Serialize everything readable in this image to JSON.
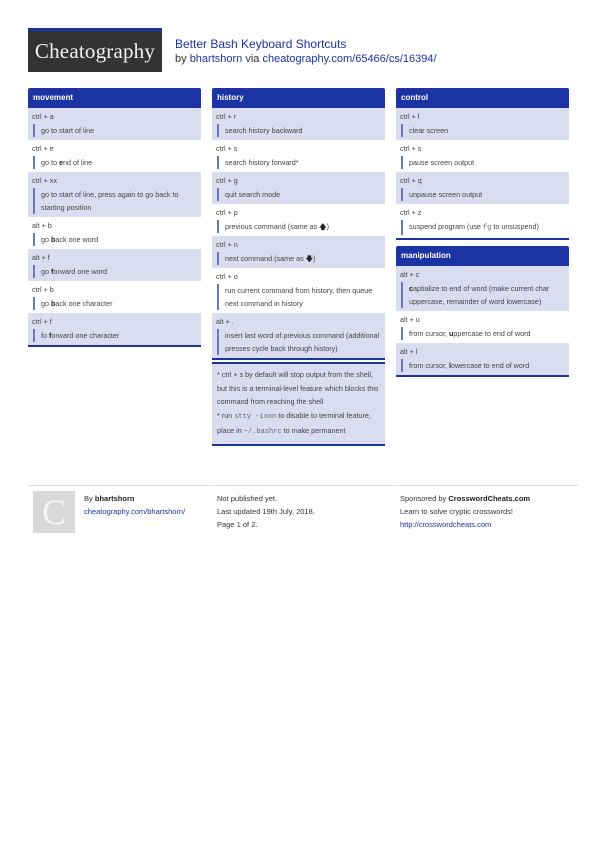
{
  "header": {
    "logo": "Cheatography",
    "title": "Better Bash Keyboard Shortcuts",
    "by_prefix": "by",
    "author": "bhartshorn",
    "via": "via",
    "url": "cheatography.com/65466/cs/16394/"
  },
  "sections": {
    "movement": {
      "title": "movement",
      "entries": [
        {
          "key": "ctrl + a",
          "desc": "go to start of line"
        },
        {
          "key": "ctrl + e",
          "pre": "go to ",
          "bold": "e",
          "post": "nd of line"
        },
        {
          "key": "ctrl + xx",
          "desc": "go to start of line, press again to go back to starting position"
        },
        {
          "key": "alt + b",
          "pre": "go ",
          "bold": "b",
          "post": "ack one word"
        },
        {
          "key": "alt + f",
          "pre": "go ",
          "bold": "f",
          "post": "orward one word"
        },
        {
          "key": "ctrl + b",
          "pre": "go ",
          "bold": "b",
          "post": "ack one character"
        },
        {
          "key": "ctrl + f",
          "pre": "fo ",
          "bold": "f",
          "post": "orward one character"
        }
      ]
    },
    "history": {
      "title": "history",
      "entries": [
        {
          "key": "ctrl + r",
          "desc": "search history backward"
        },
        {
          "key": "ctrl + s",
          "desc": "search history forward*"
        },
        {
          "key": "ctrl + g",
          "desc": "quit search mode"
        },
        {
          "key": "ctrl + p",
          "pre": "previous command (same as ",
          "icon": "🡅",
          "post": ")"
        },
        {
          "key": "ctrl + n",
          "pre": "next command (same as ",
          "icon": "🡇",
          "post": ")"
        },
        {
          "key": "ctrl + o",
          "desc": "run current command from history, then queue next command in history"
        },
        {
          "key": "alt + .",
          "desc": "insert last word of previous command (additional presses cycle back through history)"
        }
      ],
      "note": {
        "line1": "* ctrl + s by default will stop output from the shell, but this is a terminal-level feature which blocks this command from reaching the shell",
        "line2_pre": "* run ",
        "line2_code": "stty -ixon",
        "line2_mid": " to disable to terminal feature, place in ",
        "line2_code2": "~/.bashrc",
        "line2_post": " to make permanent"
      }
    },
    "control": {
      "title": "control",
      "entries": [
        {
          "key": "ctrl + l",
          "desc": "clear screen"
        },
        {
          "key": "ctrl + s",
          "desc": "pause screen output"
        },
        {
          "key": "ctrl + q",
          "desc": "unpause screen output"
        },
        {
          "key": "ctrl + z",
          "pre": "suspend program (use ",
          "code": "fg",
          "post": " to unsuspend)"
        }
      ]
    },
    "manipulation": {
      "title": "manipulation",
      "entries": [
        {
          "key": "alt + c",
          "pre": "",
          "bold": "c",
          "post": "aptialize to end of word (make current char uppercase, remainder of word lowercase)"
        },
        {
          "key": "alt + u",
          "pre": "from cursor, ",
          "bold": "u",
          "post": "ppercase to end of word"
        },
        {
          "key": "alt + l",
          "pre": "from cursor, ",
          "bold": "l",
          "post": "owercase to end of word"
        }
      ]
    }
  },
  "footer": {
    "avatar_letter": "C",
    "by_label": "By",
    "author": "bhartshorn",
    "author_url": "cheatography.com/bhartshorn/",
    "published": "Not published yet.",
    "updated": "Last updated 19th July, 2018.",
    "page": "Page 1 of 2.",
    "sponsor_label": "Sponsored by",
    "sponsor": "CrosswordCheats.com",
    "sponsor_tagline": "Learn to solve cryptic crosswords!",
    "sponsor_url": "http://crosswordcheats.com"
  },
  "colors": {
    "brand_blue": "#1c34a3",
    "row_shade": "#d9ddef",
    "logo_bg": "#333333"
  }
}
